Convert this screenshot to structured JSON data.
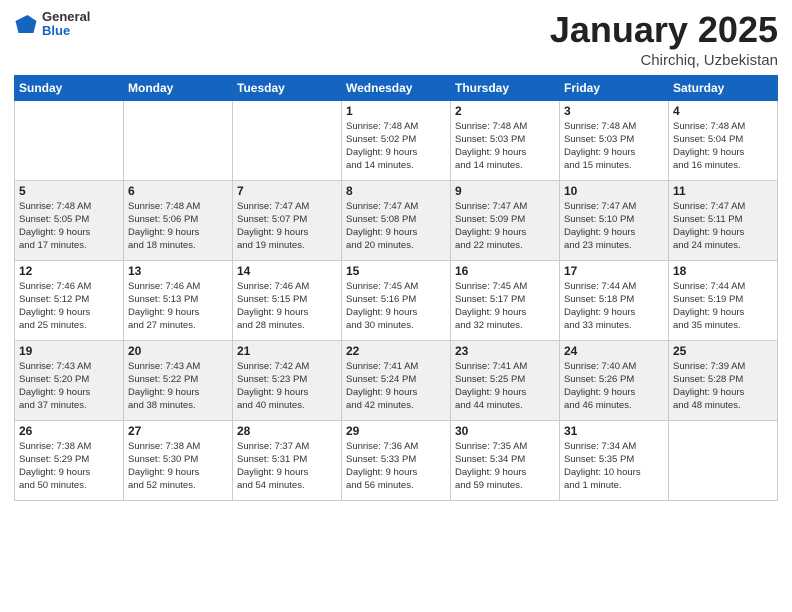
{
  "logo": {
    "general": "General",
    "blue": "Blue"
  },
  "header": {
    "month": "January 2025",
    "location": "Chirchiq, Uzbekistan"
  },
  "weekdays": [
    "Sunday",
    "Monday",
    "Tuesday",
    "Wednesday",
    "Thursday",
    "Friday",
    "Saturday"
  ],
  "weeks": [
    [
      {
        "day": "",
        "info": ""
      },
      {
        "day": "",
        "info": ""
      },
      {
        "day": "",
        "info": ""
      },
      {
        "day": "1",
        "info": "Sunrise: 7:48 AM\nSunset: 5:02 PM\nDaylight: 9 hours\nand 14 minutes."
      },
      {
        "day": "2",
        "info": "Sunrise: 7:48 AM\nSunset: 5:03 PM\nDaylight: 9 hours\nand 14 minutes."
      },
      {
        "day": "3",
        "info": "Sunrise: 7:48 AM\nSunset: 5:03 PM\nDaylight: 9 hours\nand 15 minutes."
      },
      {
        "day": "4",
        "info": "Sunrise: 7:48 AM\nSunset: 5:04 PM\nDaylight: 9 hours\nand 16 minutes."
      }
    ],
    [
      {
        "day": "5",
        "info": "Sunrise: 7:48 AM\nSunset: 5:05 PM\nDaylight: 9 hours\nand 17 minutes."
      },
      {
        "day": "6",
        "info": "Sunrise: 7:48 AM\nSunset: 5:06 PM\nDaylight: 9 hours\nand 18 minutes."
      },
      {
        "day": "7",
        "info": "Sunrise: 7:47 AM\nSunset: 5:07 PM\nDaylight: 9 hours\nand 19 minutes."
      },
      {
        "day": "8",
        "info": "Sunrise: 7:47 AM\nSunset: 5:08 PM\nDaylight: 9 hours\nand 20 minutes."
      },
      {
        "day": "9",
        "info": "Sunrise: 7:47 AM\nSunset: 5:09 PM\nDaylight: 9 hours\nand 22 minutes."
      },
      {
        "day": "10",
        "info": "Sunrise: 7:47 AM\nSunset: 5:10 PM\nDaylight: 9 hours\nand 23 minutes."
      },
      {
        "day": "11",
        "info": "Sunrise: 7:47 AM\nSunset: 5:11 PM\nDaylight: 9 hours\nand 24 minutes."
      }
    ],
    [
      {
        "day": "12",
        "info": "Sunrise: 7:46 AM\nSunset: 5:12 PM\nDaylight: 9 hours\nand 25 minutes."
      },
      {
        "day": "13",
        "info": "Sunrise: 7:46 AM\nSunset: 5:13 PM\nDaylight: 9 hours\nand 27 minutes."
      },
      {
        "day": "14",
        "info": "Sunrise: 7:46 AM\nSunset: 5:15 PM\nDaylight: 9 hours\nand 28 minutes."
      },
      {
        "day": "15",
        "info": "Sunrise: 7:45 AM\nSunset: 5:16 PM\nDaylight: 9 hours\nand 30 minutes."
      },
      {
        "day": "16",
        "info": "Sunrise: 7:45 AM\nSunset: 5:17 PM\nDaylight: 9 hours\nand 32 minutes."
      },
      {
        "day": "17",
        "info": "Sunrise: 7:44 AM\nSunset: 5:18 PM\nDaylight: 9 hours\nand 33 minutes."
      },
      {
        "day": "18",
        "info": "Sunrise: 7:44 AM\nSunset: 5:19 PM\nDaylight: 9 hours\nand 35 minutes."
      }
    ],
    [
      {
        "day": "19",
        "info": "Sunrise: 7:43 AM\nSunset: 5:20 PM\nDaylight: 9 hours\nand 37 minutes."
      },
      {
        "day": "20",
        "info": "Sunrise: 7:43 AM\nSunset: 5:22 PM\nDaylight: 9 hours\nand 38 minutes."
      },
      {
        "day": "21",
        "info": "Sunrise: 7:42 AM\nSunset: 5:23 PM\nDaylight: 9 hours\nand 40 minutes."
      },
      {
        "day": "22",
        "info": "Sunrise: 7:41 AM\nSunset: 5:24 PM\nDaylight: 9 hours\nand 42 minutes."
      },
      {
        "day": "23",
        "info": "Sunrise: 7:41 AM\nSunset: 5:25 PM\nDaylight: 9 hours\nand 44 minutes."
      },
      {
        "day": "24",
        "info": "Sunrise: 7:40 AM\nSunset: 5:26 PM\nDaylight: 9 hours\nand 46 minutes."
      },
      {
        "day": "25",
        "info": "Sunrise: 7:39 AM\nSunset: 5:28 PM\nDaylight: 9 hours\nand 48 minutes."
      }
    ],
    [
      {
        "day": "26",
        "info": "Sunrise: 7:38 AM\nSunset: 5:29 PM\nDaylight: 9 hours\nand 50 minutes."
      },
      {
        "day": "27",
        "info": "Sunrise: 7:38 AM\nSunset: 5:30 PM\nDaylight: 9 hours\nand 52 minutes."
      },
      {
        "day": "28",
        "info": "Sunrise: 7:37 AM\nSunset: 5:31 PM\nDaylight: 9 hours\nand 54 minutes."
      },
      {
        "day": "29",
        "info": "Sunrise: 7:36 AM\nSunset: 5:33 PM\nDaylight: 9 hours\nand 56 minutes."
      },
      {
        "day": "30",
        "info": "Sunrise: 7:35 AM\nSunset: 5:34 PM\nDaylight: 9 hours\nand 59 minutes."
      },
      {
        "day": "31",
        "info": "Sunrise: 7:34 AM\nSunset: 5:35 PM\nDaylight: 10 hours\nand 1 minute."
      },
      {
        "day": "",
        "info": ""
      }
    ]
  ]
}
